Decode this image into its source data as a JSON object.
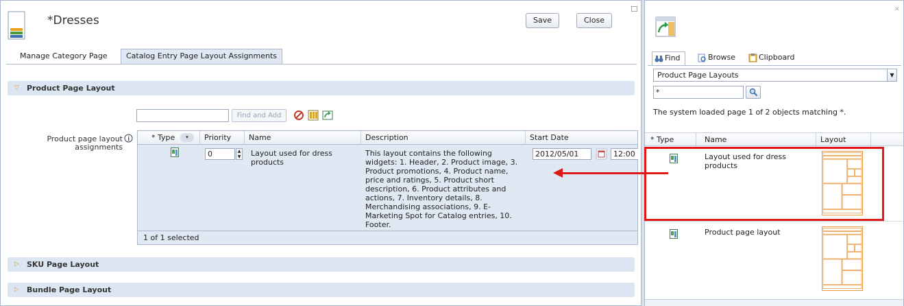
{
  "editor": {
    "title": "*Dresses",
    "save_label": "Save",
    "close_label": "Close",
    "tabs": [
      "Manage Category Page",
      "Catalog Entry Page Layout Assignments"
    ],
    "sections": {
      "product": "Product Page Layout",
      "sku": "SKU Page Layout",
      "bundle": "Bundle Page Layout"
    },
    "find_and_add_label": "Find and Add",
    "field_label": "Product page layout",
    "field_label_2": "assignments",
    "grid": {
      "columns": [
        "* Type",
        "Priority",
        "Name",
        "Description",
        "Start Date"
      ],
      "row": {
        "priority": "0",
        "name": "Layout used for dress products",
        "description": "This layout contains the following widgets: 1. Header, 2. Product image, 3. Product promotions, 4. Product name, price and ratings, 5. Product short description, 6. Product attributes and actions, 7. Inventory details, 8. Merchandising associations, 9. E-Marketing Spot for Catalog entries, 10. Footer.",
        "start_date": "2012/05/01",
        "start_time": "12:00"
      },
      "footer": "1 of 1 selected"
    }
  },
  "utilities": {
    "tabs": [
      "Find",
      "Browse",
      "Clipboard"
    ],
    "dropdown_value": "Product Page Layouts",
    "search_value": "*",
    "status": "The system loaded page 1 of 2 objects matching *.",
    "columns": [
      "* Type",
      "Name",
      "Layout"
    ],
    "results": [
      {
        "name": "Layout used for dress products"
      },
      {
        "name": "Product page layout"
      }
    ]
  },
  "colors": {
    "accent": "#e01818",
    "header_bg": "#dce6f2",
    "selected_row": "#dfe8f3"
  }
}
